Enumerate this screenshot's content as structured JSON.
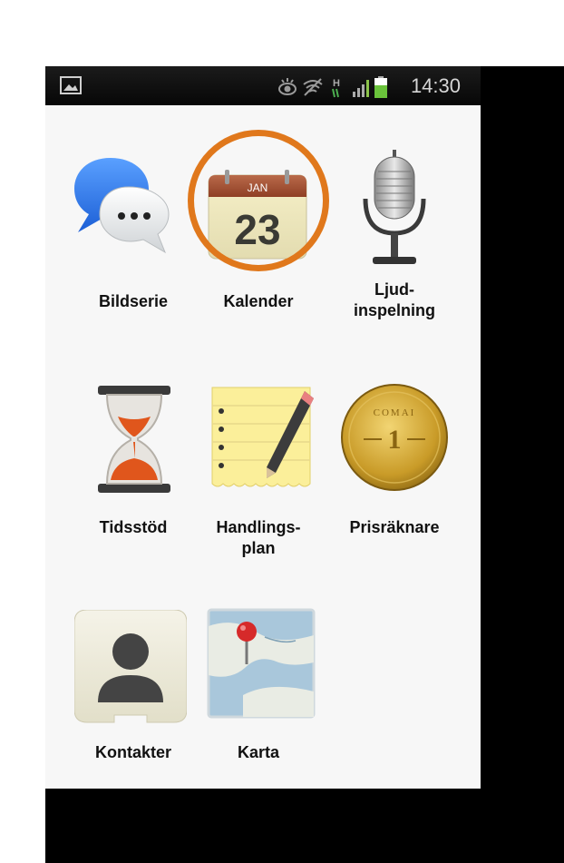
{
  "status_bar": {
    "time": "14:30"
  },
  "apps": [
    {
      "label": "Bildserie",
      "icon": "speech-bubbles-icon"
    },
    {
      "label": "Kalender",
      "icon": "calendar-icon",
      "month": "JAN",
      "day": "23",
      "highlighted": true
    },
    {
      "label": "Ljud-\ninspelning",
      "icon": "microphone-icon"
    },
    {
      "label": "Tidsstöd",
      "icon": "hourglass-icon"
    },
    {
      "label": "Handlings-\nplan",
      "icon": "notepad-pencil-icon"
    },
    {
      "label": "Prisräknare",
      "icon": "gold-coin-icon",
      "coin_text": "COMAI",
      "coin_value": "1"
    },
    {
      "label": "Kontakter",
      "icon": "contact-person-icon"
    },
    {
      "label": "Karta",
      "icon": "map-pin-icon"
    }
  ],
  "colors": {
    "highlight": "#e0781c",
    "background": "#f7f7f7",
    "frame": "#000000"
  }
}
